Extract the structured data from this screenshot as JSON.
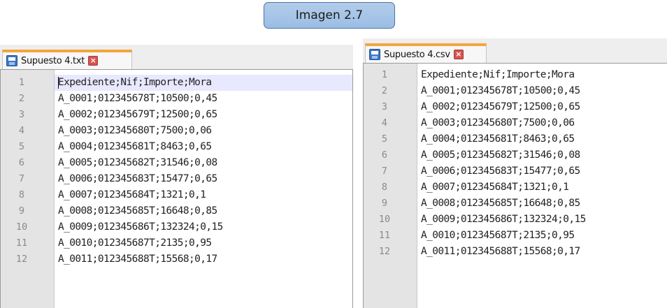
{
  "caption": "Imagen 2.7",
  "panels": [
    {
      "tab_label": "Supuesto 4.txt",
      "lines": [
        {
          "n": "1",
          "text": "Expediente;Nif;Importe;Mora"
        },
        {
          "n": "2",
          "text": "A_0001;012345678T;10500;0,45"
        },
        {
          "n": "3",
          "text": "A_0002;012345679T;12500;0,65"
        },
        {
          "n": "4",
          "text": "A_0003;012345680T;7500;0,06"
        },
        {
          "n": "5",
          "text": "A_0004;012345681T;8463;0,65"
        },
        {
          "n": "6",
          "text": "A_0005;012345682T;31546;0,08"
        },
        {
          "n": "7",
          "text": "A_0006;012345683T;15477;0,65"
        },
        {
          "n": "8",
          "text": "A_0007;012345684T;1321;0,1"
        },
        {
          "n": "9",
          "text": "A_0008;012345685T;16648;0,85"
        },
        {
          "n": "10",
          "text": "A_0009;012345686T;132324;0,15"
        },
        {
          "n": "11",
          "text": "A_0010;012345687T;2135;0,95"
        },
        {
          "n": "12",
          "text": "A_0011;012345688T;15568;0,17"
        }
      ]
    },
    {
      "tab_label": "Supuesto 4.csv",
      "lines": [
        {
          "n": "1",
          "text": "Expediente;Nif;Importe;Mora"
        },
        {
          "n": "2",
          "text": "A_0001;012345678T;10500;0,45"
        },
        {
          "n": "3",
          "text": "A_0002;012345679T;12500;0,65"
        },
        {
          "n": "4",
          "text": "A_0003;012345680T;7500;0,06"
        },
        {
          "n": "5",
          "text": "A_0004;012345681T;8463;0,65"
        },
        {
          "n": "6",
          "text": "A_0005;012345682T;31546;0,08"
        },
        {
          "n": "7",
          "text": "A_0006;012345683T;15477;0,65"
        },
        {
          "n": "8",
          "text": "A_0007;012345684T;1321;0,1"
        },
        {
          "n": "9",
          "text": "A_0008;012345685T;16648;0,85"
        },
        {
          "n": "10",
          "text": "A_0009;012345686T;132324;0,15"
        },
        {
          "n": "11",
          "text": "A_0010;012345687T;2135;0,95"
        },
        {
          "n": "12",
          "text": "A_0011;012345688T;15568;0,17"
        }
      ]
    }
  ],
  "icons": {
    "tab_icon": "floppy-save-icon",
    "close_icon": "close-icon"
  },
  "colors": {
    "tab_accent": "#f4a53d",
    "current_line": "#e8e8ff",
    "caption_fill": "#9bbde4",
    "caption_border": "#4b72a5",
    "close_button": "#d9534f"
  }
}
